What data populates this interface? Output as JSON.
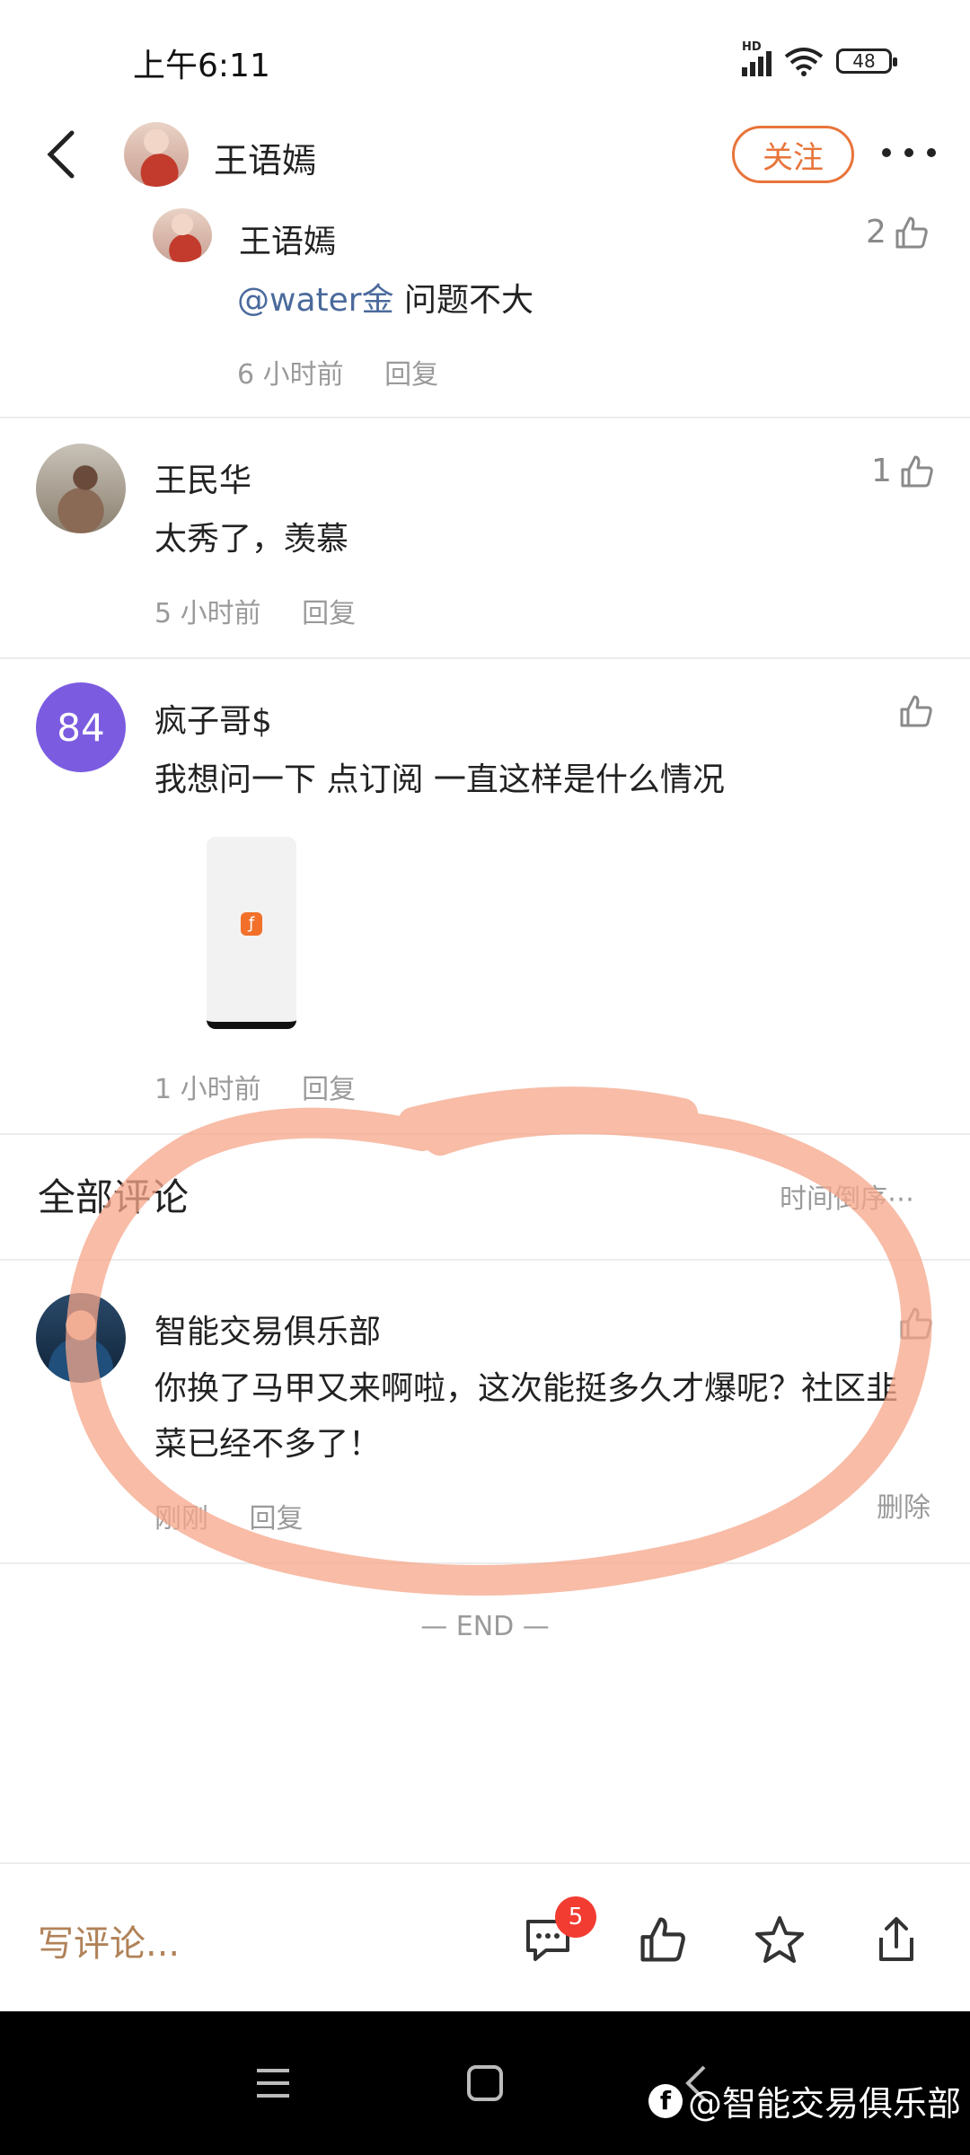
{
  "status_bar": {
    "time": "上午6:11",
    "signal_label": "HD",
    "battery": "48"
  },
  "header": {
    "back_label": "‹",
    "title": "王语嫣",
    "follow_label": "关注"
  },
  "comments": [
    {
      "name": "王语嫣",
      "mention": "@water金",
      "text": " 问题不大",
      "time": "6 小时前",
      "reply": "回复",
      "likes": "2"
    },
    {
      "name": "王民华",
      "text": "太秀了，羡慕",
      "time": "5 小时前",
      "reply": "回复",
      "likes": "1"
    },
    {
      "name": "疯子哥$",
      "avatar_text": "84",
      "text": "我想问一下 点订阅 一直这样是什么情况",
      "time": "1 小时前",
      "reply": "回复",
      "likes": ""
    }
  ],
  "all_comments": {
    "title": "全部评论",
    "sort_label": "时间倒序⋯",
    "items": [
      {
        "name": "智能交易俱乐部",
        "text": "你换了马甲又来啊啦，这次能挺多久才爆呢？社区韭菜已经不多了！",
        "time": "刚刚",
        "reply": "回复",
        "delete": "删除"
      }
    ]
  },
  "end_label": "— END —",
  "bottom": {
    "write_placeholder": "写评论...",
    "comment_count": "5"
  },
  "watermark": {
    "logo": "f",
    "text": "@智能交易俱乐部"
  },
  "colors": {
    "accent": "#e8743a",
    "mention": "#4a6a9c",
    "badge": "#f23c32",
    "annotation": "#f6a58a"
  }
}
